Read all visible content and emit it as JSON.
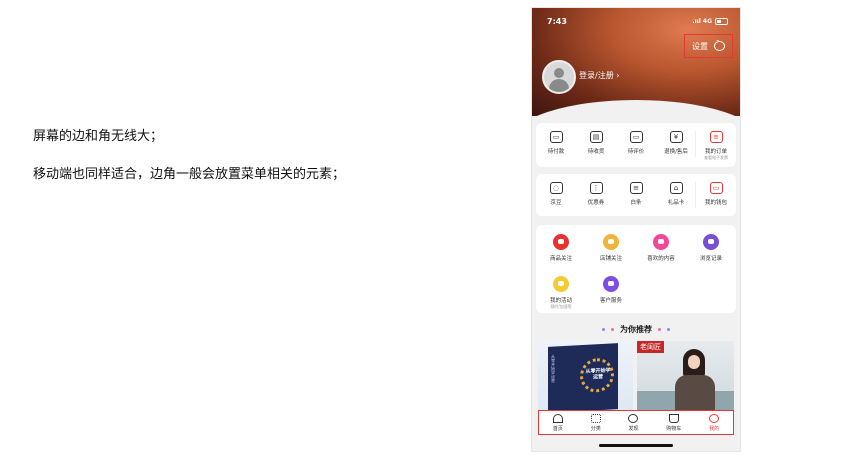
{
  "notes": {
    "line1": "屏幕的边和角无线大；",
    "line2": "移动端也同样适合，边角一般会放置菜单相关的元素；"
  },
  "status_bar": {
    "time": "7:43",
    "network": ".ııl 4G"
  },
  "header": {
    "settings_label": "设置",
    "login_label": "登录/注册 ›"
  },
  "orders": [
    {
      "label": "待付款",
      "icon": "wallet-icon",
      "glyph": "▭"
    },
    {
      "label": "待收货",
      "icon": "box-icon",
      "glyph": "▤"
    },
    {
      "label": "待评价",
      "icon": "comment-icon",
      "glyph": "▭"
    },
    {
      "label": "退换/售后",
      "icon": "refund-icon",
      "glyph": "¥"
    },
    {
      "label": "我的订单",
      "sub": "查看电子发票",
      "icon": "order-icon",
      "glyph": "≡"
    }
  ],
  "assets": [
    {
      "label": "京豆",
      "icon": "bean-icon",
      "glyph": "◌"
    },
    {
      "label": "优惠券",
      "icon": "coupon-icon",
      "glyph": "⋮"
    },
    {
      "label": "白条",
      "icon": "ious-icon",
      "glyph": "≡"
    },
    {
      "label": "礼品卡",
      "icon": "gift-icon",
      "glyph": "⌂"
    },
    {
      "label": "我的钱包",
      "icon": "wallet-icon",
      "glyph": "▭"
    }
  ],
  "services": [
    {
      "label": "商品关注",
      "icon": "product-follow-icon"
    },
    {
      "label": "店铺关注",
      "icon": "store-follow-icon"
    },
    {
      "label": "喜欢的内容",
      "icon": "heart-icon"
    },
    {
      "label": "浏览记录",
      "icon": "history-icon"
    },
    {
      "label": "我的活动",
      "sub": "预约/加速等",
      "icon": "activity-icon"
    },
    {
      "label": "客户服务",
      "icon": "service-icon"
    }
  ],
  "recommend": {
    "title": "为你推荐"
  },
  "products": {
    "book_title": "从零开始学运营",
    "book_spine": "从零开始学运营",
    "brand": "老闺匠"
  },
  "tabs": [
    {
      "label": "首页",
      "icon": "home-icon"
    },
    {
      "label": "分类",
      "icon": "category-icon"
    },
    {
      "label": "发现",
      "icon": "discover-icon"
    },
    {
      "label": "购物车",
      "icon": "cart-icon"
    },
    {
      "label": "我的",
      "icon": "profile-icon",
      "active": true
    }
  ],
  "colors": {
    "accent": "#e53935",
    "hero": "#b8562f"
  }
}
